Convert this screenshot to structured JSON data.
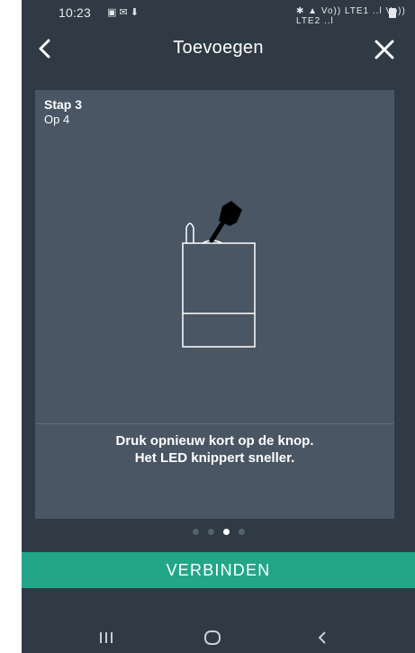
{
  "status_bar": {
    "time": "10:23",
    "left_icons": "▣ ✉ ⬇",
    "right_icons": "✱ ▲ Vo)) LTE1 ..l Vo)) LTE2 ..l"
  },
  "app_bar": {
    "title": "Toevoegen",
    "back_icon": "chevron-left-icon",
    "close_icon": "close-icon"
  },
  "step": {
    "label": "Stap 3",
    "sub_label": "Op 4",
    "instruction_line1": "Druk opnieuw kort op de knop.",
    "instruction_line2": "Het LED knippert sneller."
  },
  "pager": {
    "count": 4,
    "active_index": 2
  },
  "action": {
    "connect_label": "VERBINDEN"
  },
  "colors": {
    "background": "#2f3a44",
    "card": "#4a5664",
    "accent": "#23a688",
    "text": "#ffffff"
  }
}
